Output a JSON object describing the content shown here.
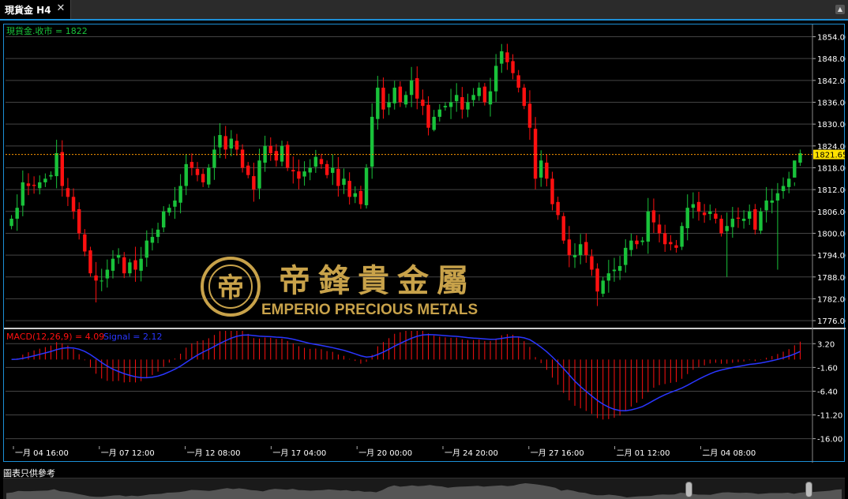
{
  "window": {
    "tab_title": "現貨金 H4",
    "close_icon": "close-icon",
    "scroll_icon": "scroll-up-icon"
  },
  "footer": {
    "disclaimer": "圖表只供參考"
  },
  "watermark": {
    "chinese_name": "帝鋒貴金屬",
    "english_name": "EMPERIO PRECIOUS METALS",
    "logo_icon": "emperio-logo-icon"
  },
  "colors": {
    "bull": "#19c23a",
    "bear": "#ff1010",
    "signal": "#2a36ff",
    "grid": "#444444",
    "axis_text": "#ffffff",
    "price_marker_bg": "#ffe200",
    "price_marker_text": "#000000",
    "gold": "#c8a24a"
  },
  "chart_data": [
    {
      "type": "candlestick",
      "legend": "現貨金.收市 = 1822",
      "y_ticks": [
        1854,
        1848,
        1842,
        1836,
        1830,
        1824,
        1818,
        1812,
        1806,
        1800,
        1794,
        1788,
        1782,
        1776
      ],
      "y_tick_labels": [
        "1854.00",
        "1848.00",
        "1842.00",
        "1836.00",
        "1830.00",
        "1824.00",
        "1818.00",
        "1812.00",
        "1806.00",
        "1800.00",
        "1794.00",
        "1788.00",
        "1782.00",
        "1776.00"
      ],
      "ylim": [
        1774.5,
        1856.5
      ],
      "current_price": 1821.65,
      "current_price_label": "1821.65",
      "x_labels": [
        "一月 04 16:00",
        "一月 07 12:00",
        "一月 12 08:00",
        "一月 17 04:00",
        "一月 20 00:00",
        "一月 24 20:00",
        "一月 27 16:00",
        "二月 01 12:00",
        "二月 04 08:00"
      ],
      "close": [
        1804,
        1807,
        1814,
        1813,
        1813,
        1814,
        1815,
        1816,
        1822,
        1813,
        1810,
        1806,
        1800,
        1795,
        1789,
        1787,
        1787,
        1790,
        1793,
        1794,
        1789,
        1792,
        1790,
        1793,
        1798,
        1799,
        1801,
        1806,
        1807,
        1809,
        1813,
        1819,
        1818,
        1816,
        1814,
        1818,
        1823,
        1827,
        1823,
        1826,
        1823,
        1818,
        1816,
        1812,
        1820,
        1824,
        1822,
        1820,
        1824,
        1818,
        1817,
        1815,
        1817,
        1818,
        1821,
        1819,
        1816,
        1818,
        1813,
        1815,
        1810,
        1811,
        1808,
        1818,
        1832,
        1840,
        1834,
        1836,
        1840,
        1836,
        1838,
        1842,
        1837,
        1835,
        1829,
        1832,
        1834,
        1835,
        1836,
        1838,
        1834,
        1836,
        1838,
        1840,
        1836,
        1839,
        1846,
        1850,
        1847,
        1844,
        1840,
        1835,
        1829,
        1815,
        1820,
        1815,
        1808,
        1805,
        1798,
        1794,
        1794,
        1797,
        1794,
        1790,
        1784,
        1787,
        1789,
        1790,
        1791,
        1796,
        1798,
        1797,
        1798,
        1806,
        1803,
        1800,
        1797,
        1797,
        1796,
        1802,
        1807,
        1808,
        1806,
        1805,
        1806,
        1804,
        1800,
        1802,
        1804,
        1804,
        1804,
        1806,
        1801,
        1806,
        1809,
        1809,
        1811,
        1813,
        1815,
        1820,
        1822
      ],
      "axis_color_note": "bull green, bear red"
    },
    {
      "type": "bar+line",
      "legend_macd": "MACD(12,26,9) = 4.09",
      "legend_signal": "Signal = 2.12",
      "y_ticks": [
        3.2,
        -1.6,
        -6.4,
        -11.2,
        -16.0
      ],
      "y_tick_labels": [
        "3.20",
        "-1.60",
        "-6.40",
        "-11.20",
        "-16.00"
      ],
      "ylim": [
        -17.5,
        5.8
      ]
    }
  ]
}
